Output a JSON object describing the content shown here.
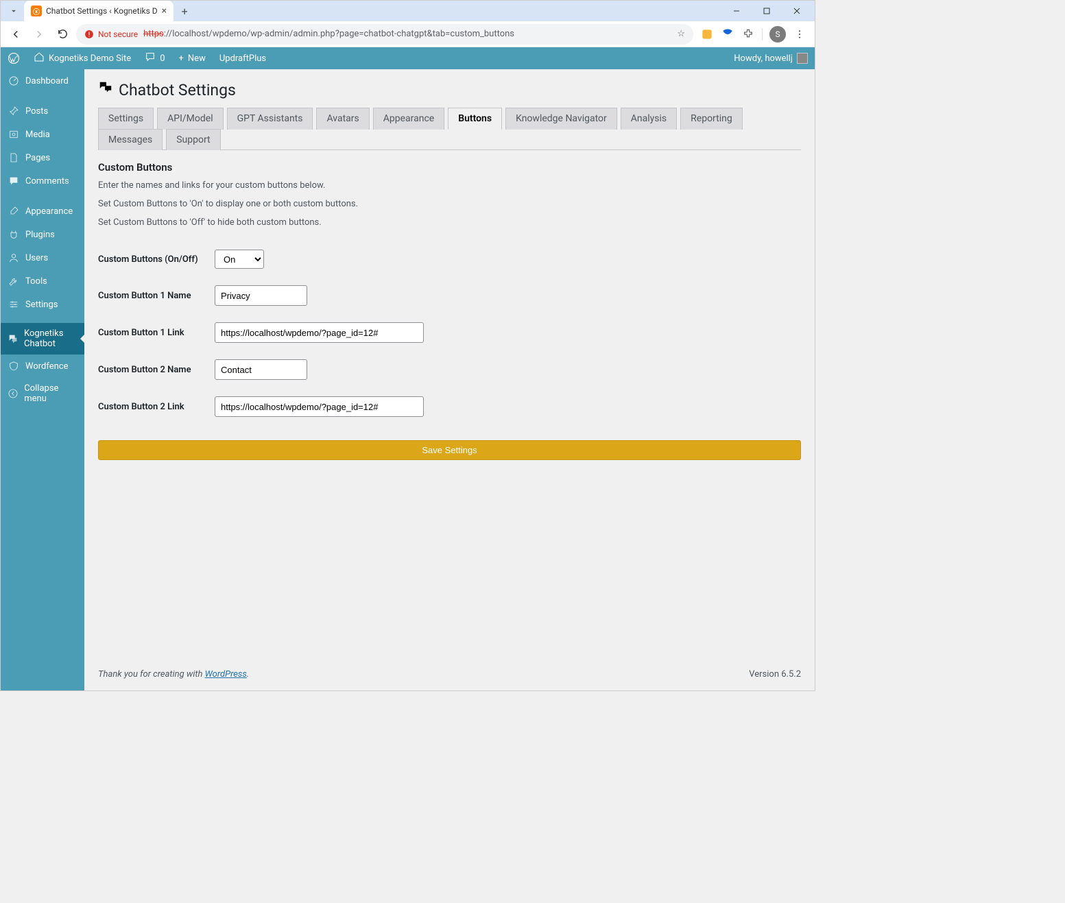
{
  "browser": {
    "tab_title": "Chatbot Settings ‹ Kognetiks D",
    "security_label": "Not secure",
    "url_protocol": "https",
    "url_rest": "://localhost/wpdemo/wp-admin/admin.php?page=chatbot-chatgpt&tab=custom_buttons",
    "avatar_letter": "S"
  },
  "adminbar": {
    "site_name": "Kognetiks Demo Site",
    "comments": "0",
    "new": "New",
    "updraft": "UpdraftPlus",
    "howdy": "Howdy, howellj"
  },
  "sidebar": {
    "items": [
      {
        "label": "Dashboard",
        "icon": "dashboard-icon"
      },
      {
        "label": "Posts",
        "icon": "pin-icon"
      },
      {
        "label": "Media",
        "icon": "media-icon"
      },
      {
        "label": "Pages",
        "icon": "page-icon"
      },
      {
        "label": "Comments",
        "icon": "comment-icon"
      },
      {
        "label": "Appearance",
        "icon": "brush-icon"
      },
      {
        "label": "Plugins",
        "icon": "plug-icon"
      },
      {
        "label": "Users",
        "icon": "user-icon"
      },
      {
        "label": "Tools",
        "icon": "wrench-icon"
      },
      {
        "label": "Settings",
        "icon": "sliders-icon"
      },
      {
        "label": "Kognetiks Chatbot",
        "icon": "chat-icon"
      },
      {
        "label": "Wordfence",
        "icon": "shield-icon"
      },
      {
        "label": "Collapse menu",
        "icon": "collapse-icon"
      }
    ]
  },
  "page": {
    "title": "Chatbot Settings",
    "tabs": [
      {
        "label": "Settings"
      },
      {
        "label": "API/Model"
      },
      {
        "label": "GPT Assistants"
      },
      {
        "label": "Avatars"
      },
      {
        "label": "Appearance"
      },
      {
        "label": "Buttons",
        "active": true
      },
      {
        "label": "Knowledge Navigator"
      },
      {
        "label": "Analysis"
      },
      {
        "label": "Reporting"
      },
      {
        "label": "Messages"
      },
      {
        "label": "Support"
      }
    ],
    "section_heading": "Custom Buttons",
    "desc1": "Enter the names and links for your custom buttons below.",
    "desc2": "Set Custom Buttons to 'On' to display one or both custom buttons.",
    "desc3": "Set Custom Buttons to 'Off' to hide both custom buttons.",
    "fields": {
      "onoff_label": "Custom Buttons (On/Off)",
      "onoff_value": "On",
      "b1name_label": "Custom Button 1 Name",
      "b1name_value": "Privacy",
      "b1link_label": "Custom Button 1 Link",
      "b1link_value": "https://localhost/wpdemo/?page_id=12#",
      "b2name_label": "Custom Button 2 Name",
      "b2name_value": "Contact",
      "b2link_label": "Custom Button 2 Link",
      "b2link_value": "https://localhost/wpdemo/?page_id=12#"
    },
    "save_label": "Save Settings",
    "footer_text": "Thank you for creating with ",
    "footer_link": "WordPress",
    "footer_period": ".",
    "version": "Version 6.5.2"
  }
}
